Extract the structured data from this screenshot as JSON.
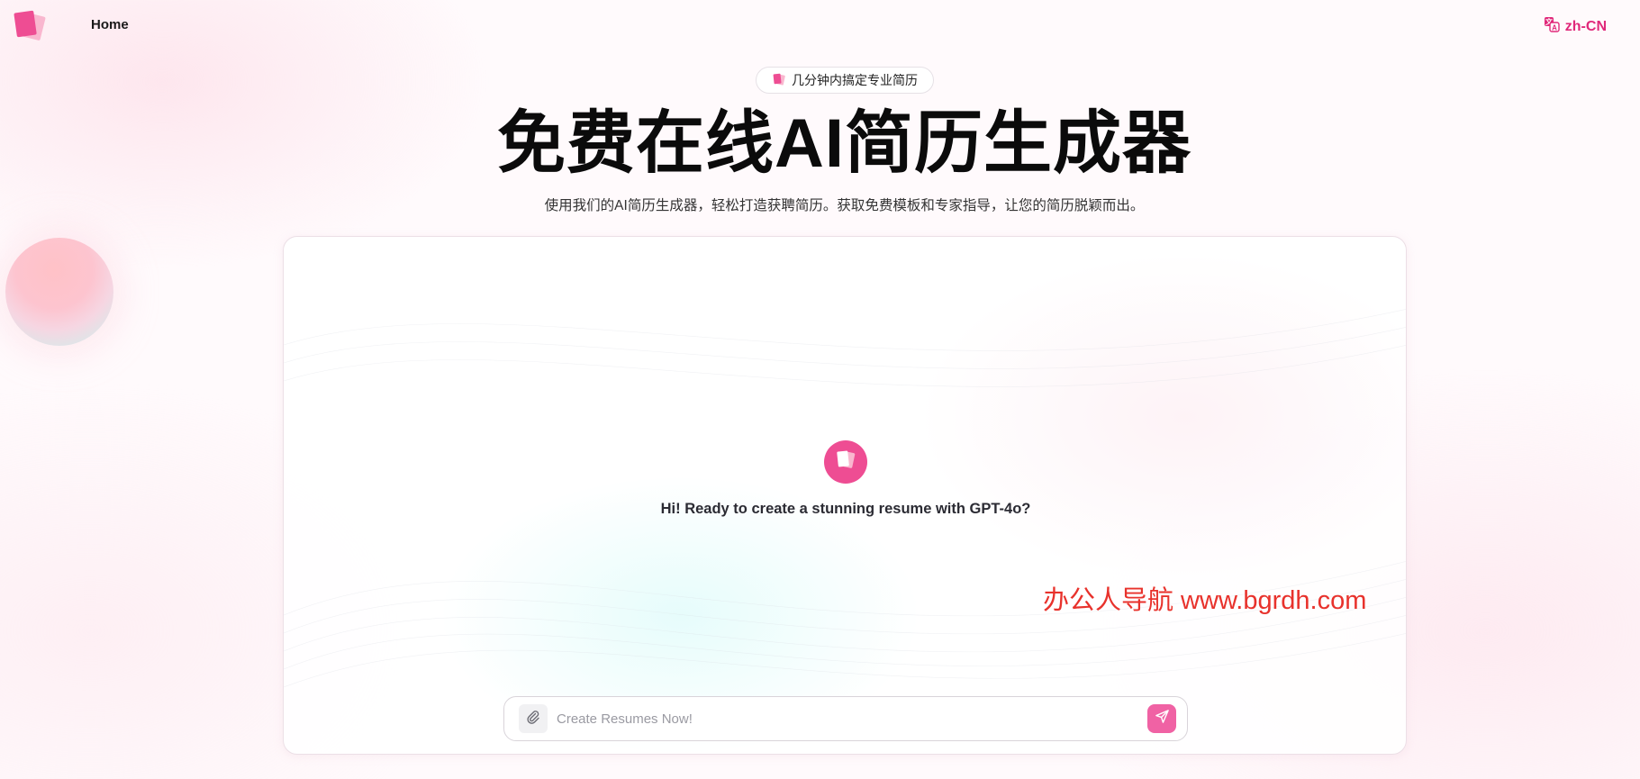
{
  "header": {
    "logo_icon": "stacked-pages-logo-icon",
    "nav_home": "Home",
    "language": "zh-CN",
    "language_icon": "translate-icon"
  },
  "hero": {
    "badge_text": "几分钟内搞定专业简历",
    "badge_icon": "stacked-pages-icon",
    "title": "免费在线AI简历生成器",
    "subtitle": "使用我们的AI简历生成器，轻松打造获聘简历。获取免费模板和专家指导，让您的简历脱颖而出。"
  },
  "chat": {
    "avatar_icon": "stacked-pages-avatar-icon",
    "greeting": "Hi! Ready to create a stunning resume with GPT-4o?",
    "watermark": "办公人导航 www.bgrdh.com",
    "input": {
      "value": "",
      "placeholder": "Create Resumes Now!",
      "attach_icon": "paperclip-icon",
      "send_icon": "send-icon"
    }
  },
  "colors": {
    "accent": "#ee4d93",
    "accent_light": "#f062a4",
    "lang_text": "#e0287a",
    "watermark": "#e8322c"
  }
}
